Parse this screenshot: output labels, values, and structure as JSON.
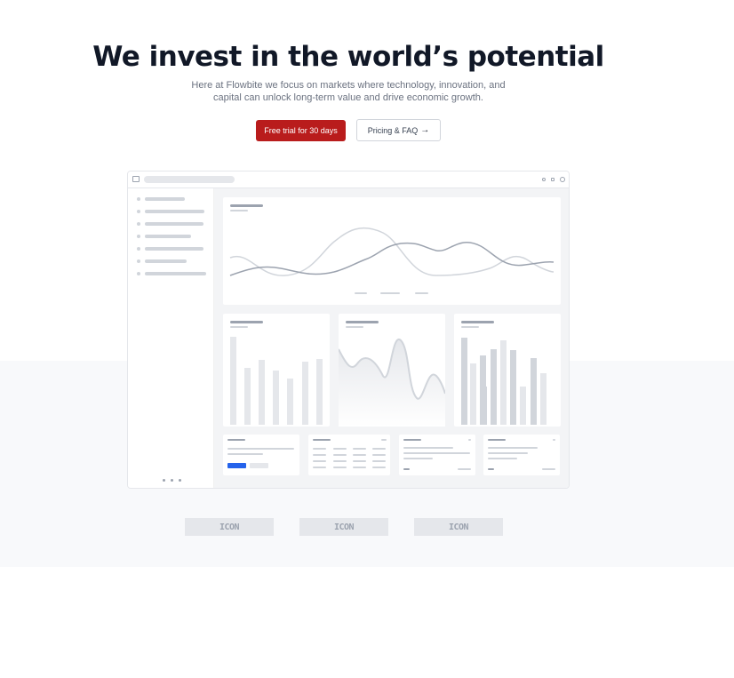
{
  "hero": {
    "title": "We invest in the world’s potential",
    "subtitle": "Here at Flowbite we focus on markets where technology, innovation, and capital can unlock long-term value and drive economic growth."
  },
  "buttons": {
    "primary_label": "Free trial for 30 days",
    "secondary_label": "Pricing & FAQ",
    "secondary_icon": "arrow-right-icon"
  },
  "logos": [
    {
      "label": "ICON"
    },
    {
      "label": "ICON"
    },
    {
      "label": "ICON"
    }
  ],
  "colors": {
    "primary": "#b91c1c",
    "title": "#111827",
    "subtitle": "#6b7280",
    "band": "#f8f9fb"
  }
}
